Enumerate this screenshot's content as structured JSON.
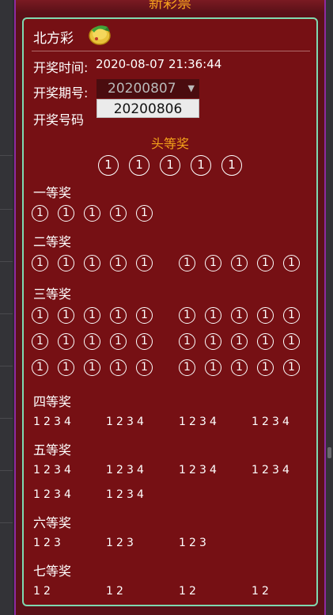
{
  "banner_title": "新彩票",
  "lottery_name": "北方彩",
  "draw_time_label": "开奖时间:",
  "draw_time_value": "2020-08-07 21:36:44",
  "issue_label": "开奖期号:",
  "issue_selected": "20200807",
  "issue_option": "20200806",
  "number_label": "开奖号码",
  "tiers": {
    "head": "头等奖",
    "t1": "一等奖",
    "t2": "二等奖",
    "t3": "三等奖",
    "t4": "四等奖",
    "t5": "五等奖",
    "t6": "六等奖",
    "t7": "七等奖"
  },
  "ball_digit": "1",
  "n1": "1",
  "n2": "2",
  "n3": "3",
  "n4": "4",
  "colors": {
    "panel": "#761014",
    "border": "#7fd9b0",
    "gold": "#f4a21a"
  },
  "icons": {
    "lottery": "lottery-coin-icon",
    "dropdown": "triangle-down-icon"
  }
}
